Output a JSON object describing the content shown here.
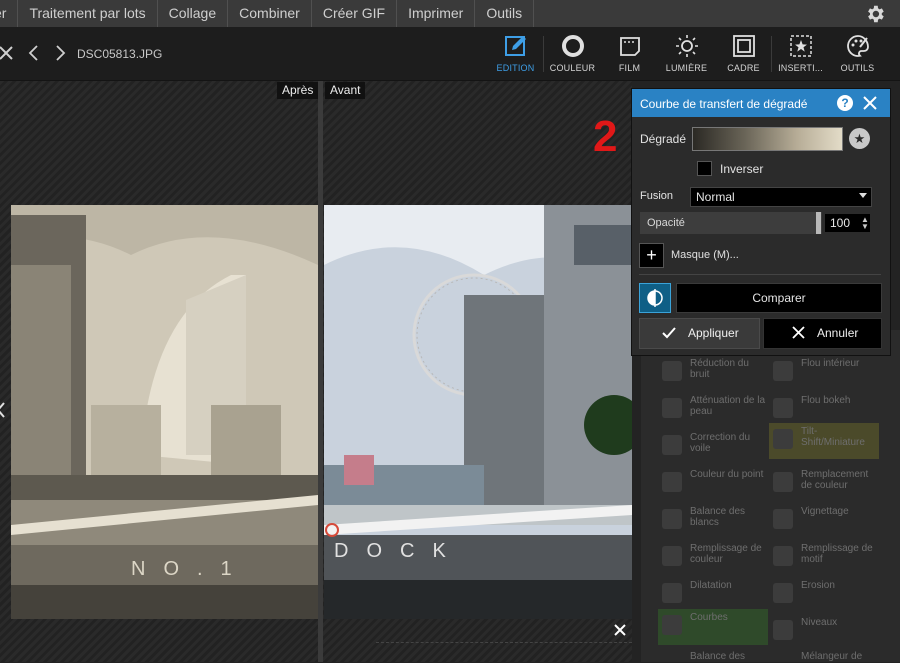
{
  "menu": {
    "items": [
      "er",
      "Traitement par lots",
      "Collage",
      "Combiner",
      "Créer GIF",
      "Imprimer",
      "Outils"
    ]
  },
  "toolbar": {
    "filename": "DSC05813.JPG",
    "tools": [
      {
        "label": "EDITION",
        "icon": "edit-icon",
        "active": true
      },
      {
        "label": "COULEUR",
        "icon": "color-circle-icon"
      },
      {
        "label": "FILM",
        "icon": "film-icon"
      },
      {
        "label": "LUMIÈRE",
        "icon": "sun-icon"
      },
      {
        "label": "CADRE",
        "icon": "frame-icon"
      },
      {
        "label": "INSERTI...",
        "icon": "insert-star-icon"
      },
      {
        "label": "OUTILS",
        "icon": "palette-icon"
      }
    ]
  },
  "canvas": {
    "after_label": "Après",
    "before_label": "Avant",
    "step_number": "2"
  },
  "dialog": {
    "title": "Courbe de transfert de dégradé",
    "help": "?",
    "gradient_label": "Dégradé",
    "invert_label": "Inverser",
    "blend_label": "Fusion",
    "blend_value": "Normal",
    "opacity_label": "Opacité",
    "opacity_value": "100",
    "mask_label": "Masque (M)...",
    "mask_plus": "+",
    "compare_label": "Comparer",
    "apply_label": "Appliquer",
    "cancel_label": "Annuler",
    "star": "★"
  },
  "side_panel": {
    "tiles": [
      "Réduction du bruit",
      "Flou intérieur",
      "Atténuation de la peau",
      "Flou bokeh",
      "Correction du voile",
      "Tilt-Shift/Miniature",
      "Couleur du point",
      "Remplacement de couleur",
      "Balance des blancs",
      "Vignettage",
      "Remplissage de couleur",
      "Remplissage de motif",
      "Dilatation",
      "Erosion",
      "Courbes",
      "Niveaux",
      "Balance des",
      "Mélangeur de"
    ]
  },
  "colors": {
    "accent": "#2a82c4",
    "active_tool": "#3e9ee6",
    "step_number": "#e01818"
  }
}
